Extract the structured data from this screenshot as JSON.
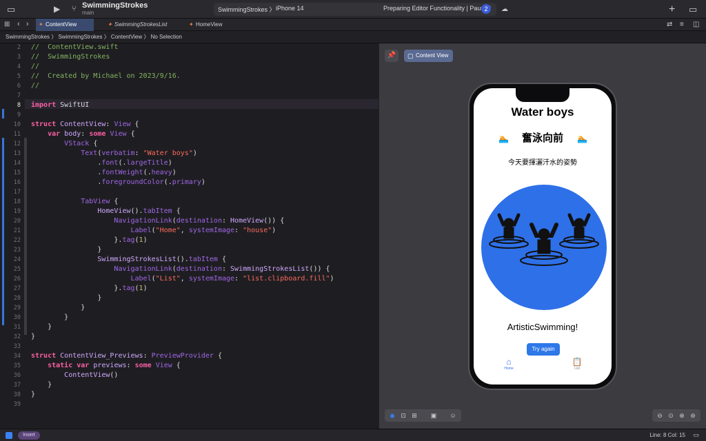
{
  "toolbar": {
    "project_name": "SwimmingStrokes",
    "branch": "main",
    "scheme_target": "SwimmingStrokes 〉",
    "scheme_device": "iPhone 14",
    "scheme_status": "Preparing Editor Functionality | Paused",
    "status_badge": "2"
  },
  "tabs": [
    {
      "label": "ContentView"
    },
    {
      "label": "SwimmingStrokesList"
    },
    {
      "label": "HomeView"
    }
  ],
  "breadcrumb": "SwimmingStrokes 〉 SwimmingStrokes 〉 ContentView 〉 No Selection",
  "editor": {
    "line_numbers": [
      "2",
      "3",
      "4",
      "5",
      "6",
      "7",
      "8",
      "9",
      "10",
      "11",
      "12",
      "13",
      "14",
      "15",
      "16",
      "17",
      "18",
      "19",
      "20",
      "21",
      "22",
      "23",
      "24",
      "25",
      "26",
      "27",
      "28",
      "29",
      "30",
      "31",
      "32",
      "33",
      "34",
      "35",
      "36",
      "37",
      "38",
      "39"
    ],
    "current_line": "8"
  },
  "preview": {
    "chip_label": "Content View",
    "app": {
      "title": "Water boys",
      "chinese_title": "奮泳向前",
      "subtitle": "今天要揮灑汗水的姿勢",
      "caption": "ArtisticSwimming!",
      "button": "Try again",
      "tab_home": "Home",
      "tab_list": "List"
    }
  },
  "status_bar": {
    "mode": "Insert",
    "position": "Line: 8  Col: 15"
  },
  "colors": {
    "accent": "#2e70e8",
    "active_tab": "#3a4a6e",
    "keyword": "#fc5fa3",
    "string": "#fc6a5d",
    "comment": "#84b360"
  }
}
